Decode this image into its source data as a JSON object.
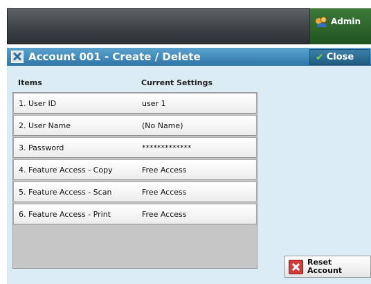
{
  "header": {
    "admin_label": "Admin"
  },
  "title_bar": {
    "title": "Account 001 - Create / Delete",
    "close_label": "Close"
  },
  "table": {
    "columns": [
      "Items",
      "Current Settings"
    ],
    "rows": [
      {
        "item": "1. User ID",
        "value": "user 1"
      },
      {
        "item": "2. User Name",
        "value": "(No Name)"
      },
      {
        "item": "3. Password",
        "value": "*************"
      },
      {
        "item": "4. Feature Access - Copy",
        "value": "Free Access"
      },
      {
        "item": "5. Feature Access - Scan",
        "value": "Free Access"
      },
      {
        "item": "6. Feature Access - Print",
        "value": "Free Access"
      }
    ]
  },
  "actions": {
    "reset_label": "Reset\nAccount"
  },
  "icons": {
    "admin": "admin-users-icon",
    "title": "tools-icon",
    "close": "checkmark-icon",
    "reset": "reset-x-icon"
  },
  "colors": {
    "title_bar": "#3a8abd",
    "admin_button": "#2a6628",
    "panel": "#dcecf5"
  }
}
